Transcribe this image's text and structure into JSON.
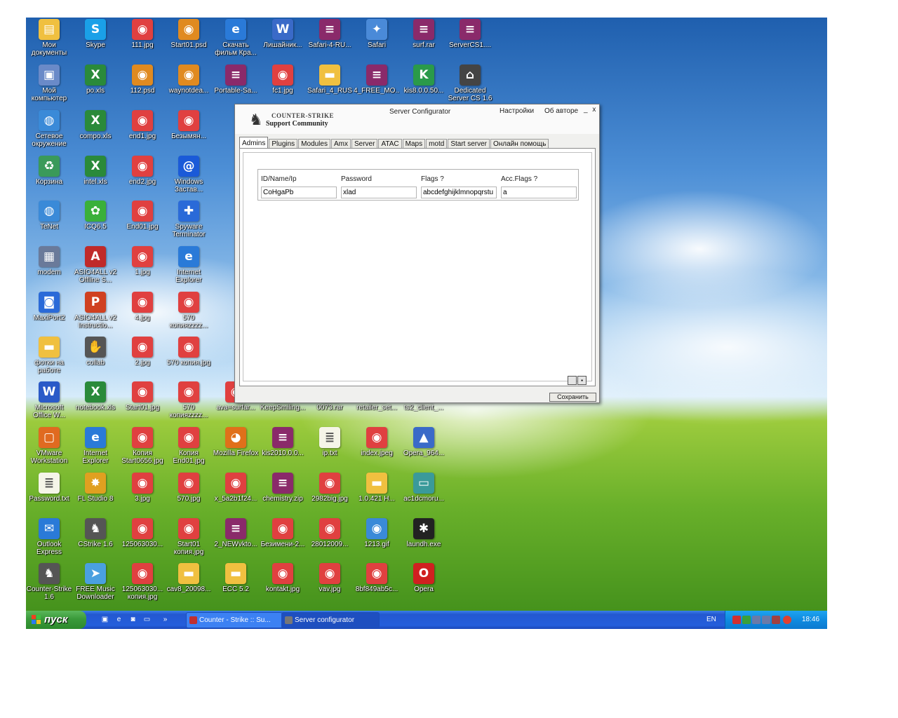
{
  "desktop": {
    "icons": [
      {
        "label": "Мои документы",
        "glyph": "folder-docs-icon",
        "color": "#f0c040",
        "sym": "▤"
      },
      {
        "label": "Skype",
        "glyph": "skype-icon",
        "color": "#1aa0e8",
        "sym": "S"
      },
      {
        "label": "111.jpg",
        "glyph": "jpg-file-icon",
        "color": "#e04040",
        "sym": "◉"
      },
      {
        "label": "Start01.psd",
        "glyph": "psd-file-icon",
        "color": "#e08a20",
        "sym": "◉"
      },
      {
        "label": "Скачать фильм Кра...",
        "glyph": "ie-icon",
        "color": "#2a7ad8",
        "sym": "e"
      },
      {
        "label": "Лишайник...",
        "glyph": "doc-file-icon",
        "color": "#3a6ac8",
        "sym": "W"
      },
      {
        "label": "Safari-4-RU...",
        "glyph": "rar-archive-icon",
        "color": "#8a2a6a",
        "sym": "≡"
      },
      {
        "label": "Safari",
        "glyph": "safari-icon",
        "color": "#4a8ad8",
        "sym": "✦"
      },
      {
        "label": "surf.rar",
        "glyph": "rar-archive-icon",
        "color": "#8a2a6a",
        "sym": "≡"
      },
      {
        "label": "ServerCS1....",
        "glyph": "rar-archive-icon",
        "color": "#8a2a6a",
        "sym": "≡"
      },
      {
        "label": "Мой компьютер",
        "glyph": "computer-icon",
        "color": "#6a8ac8",
        "sym": "▣"
      },
      {
        "label": "po.xls",
        "glyph": "xls-file-icon",
        "color": "#2a8a3a",
        "sym": "X"
      },
      {
        "label": "112.psd",
        "glyph": "psd-file-icon",
        "color": "#e08a20",
        "sym": "◉"
      },
      {
        "label": "waynotdea...",
        "glyph": "psd-file-icon",
        "color": "#e08a20",
        "sym": "◉"
      },
      {
        "label": "Portable-Sa...",
        "glyph": "rar-archive-icon",
        "color": "#8a2a6a",
        "sym": "≡"
      },
      {
        "label": "fc1.jpg",
        "glyph": "jpg-file-icon",
        "color": "#e04040",
        "sym": "◉"
      },
      {
        "label": "Safari_4_RUS",
        "glyph": "folder-icon",
        "color": "#f0c040",
        "sym": "▬"
      },
      {
        "label": "4_FREE_MO...",
        "glyph": "rar-archive-icon",
        "color": "#8a2a6a",
        "sym": "≡"
      },
      {
        "label": "kis8.0.0.50...",
        "glyph": "kaspersky-icon",
        "color": "#2a9a4a",
        "sym": "K"
      },
      {
        "label": "Dedicated Server CS 1.6",
        "glyph": "dedicated-server-icon",
        "color": "#444444",
        "sym": "⌂"
      },
      {
        "label": "Сетевое окружение",
        "glyph": "network-icon",
        "color": "#3a8ad8",
        "sym": "◍"
      },
      {
        "label": "compo.xls",
        "glyph": "xls-file-icon",
        "color": "#2a8a3a",
        "sym": "X"
      },
      {
        "label": "end1.jpg",
        "glyph": "jpg-file-icon",
        "color": "#e04040",
        "sym": "◉"
      },
      {
        "label": "Безымян...",
        "glyph": "jpg-file-icon",
        "color": "#e04040",
        "sym": "◉"
      },
      {
        "label": "Корзина",
        "glyph": "recycle-bin-icon",
        "color": "#3a9a5a",
        "sym": "♻"
      },
      {
        "label": "intel.xls",
        "glyph": "xls-file-icon",
        "color": "#2a8a3a",
        "sym": "X"
      },
      {
        "label": "end2.jpg",
        "glyph": "jpg-file-icon",
        "color": "#e04040",
        "sym": "◉"
      },
      {
        "label": "Windows Застав...",
        "glyph": "at-sign-icon",
        "color": "#1a5ad8",
        "sym": "@"
      },
      {
        "label": "TeNet",
        "glyph": "network-icon",
        "color": "#3a8ad8",
        "sym": "◍"
      },
      {
        "label": "ICQ6.5",
        "glyph": "icq-icon",
        "color": "#3ab03a",
        "sym": "✿"
      },
      {
        "label": "End01.jpg",
        "glyph": "jpg-file-icon",
        "color": "#e04040",
        "sym": "◉"
      },
      {
        "label": "Spyware Terminator",
        "glyph": "shield-icon",
        "color": "#2a6ad8",
        "sym": "✚"
      },
      {
        "label": "modem",
        "glyph": "modem-icon",
        "color": "#6a7a9a",
        "sym": "▦"
      },
      {
        "label": "ASIO4ALL v2 Offline S...",
        "glyph": "asio-icon",
        "color": "#c02a2a",
        "sym": "A"
      },
      {
        "label": "1.jpg",
        "glyph": "jpg-file-icon",
        "color": "#e04040",
        "sym": "◉"
      },
      {
        "label": "Internet Explorer",
        "glyph": "ie-icon",
        "color": "#2a7ad8",
        "sym": "e"
      },
      {
        "label": "MaxiPort2",
        "glyph": "maxiport-icon",
        "color": "#2a6ad8",
        "sym": "◙"
      },
      {
        "label": "ASIO4ALL v2 Instructio...",
        "glyph": "pdf-file-icon",
        "color": "#d04020",
        "sym": "P"
      },
      {
        "label": "4.jpg",
        "glyph": "jpg-file-icon",
        "color": "#e04040",
        "sym": "◉"
      },
      {
        "label": "570 копияzzzz...",
        "glyph": "jpg-file-icon",
        "color": "#e04040",
        "sym": "◉"
      },
      {
        "label": "фотки на работе",
        "glyph": "folder-icon",
        "color": "#f0c040",
        "sym": "▬"
      },
      {
        "label": "collab",
        "glyph": "collab-icon",
        "color": "#555555",
        "sym": "✋"
      },
      {
        "label": "2.jpg",
        "glyph": "jpg-file-icon",
        "color": "#e04040",
        "sym": "◉"
      },
      {
        "label": "570 копия.jpg",
        "glyph": "jpg-file-icon",
        "color": "#e04040",
        "sym": "◉"
      },
      {
        "label": "Microsoft Office W...",
        "glyph": "word-icon",
        "color": "#2a5ac8",
        "sym": "W"
      },
      {
        "label": "notebook.xls",
        "glyph": "xls-file-icon",
        "color": "#2a8a3a",
        "sym": "X"
      },
      {
        "label": "Start01.jpg",
        "glyph": "jpg-file-icon",
        "color": "#e04040",
        "sym": "◉"
      },
      {
        "label": "570 копияzzzz...",
        "glyph": "jpg-file-icon",
        "color": "#e04040",
        "sym": "◉"
      },
      {
        "label": "ava=surfar...",
        "glyph": "jpg-file-icon",
        "color": "#e04040",
        "sym": "◉"
      },
      {
        "label": "KeepSmiling...",
        "glyph": "jpg-file-icon",
        "color": "#e04040",
        "sym": "◉"
      },
      {
        "label": "0073.rar",
        "glyph": "rar-archive-icon",
        "color": "#8a2a6a",
        "sym": "≡"
      },
      {
        "label": "retailer_set...",
        "glyph": "rar-archive-icon",
        "color": "#8a2a6a",
        "sym": "≡"
      },
      {
        "label": "ts2_client_...",
        "glyph": "rar-archive-icon",
        "color": "#8a2a6a",
        "sym": "≡"
      },
      {
        "label": "VMware Workstation",
        "glyph": "vmware-icon",
        "color": "#e06a20",
        "sym": "▢"
      },
      {
        "label": "Internet Explorer",
        "glyph": "ie-icon",
        "color": "#2a7ad8",
        "sym": "e"
      },
      {
        "label": "Копия Start0656.jpg",
        "glyph": "jpg-file-icon",
        "color": "#e04040",
        "sym": "◉"
      },
      {
        "label": "Копия End01.jpg",
        "glyph": "jpg-file-icon",
        "color": "#e04040",
        "sym": "◉"
      },
      {
        "label": "Mozilla Firefox",
        "glyph": "firefox-icon",
        "color": "#e0701a",
        "sym": "◕"
      },
      {
        "label": "kis2010.0.0...",
        "glyph": "rar-archive-icon",
        "color": "#8a2a6a",
        "sym": "≡"
      },
      {
        "label": "ip.txt",
        "glyph": "txt-file-icon",
        "color": "#f5f5e8",
        "sym": "≣"
      },
      {
        "label": "index.jpeg",
        "glyph": "jpg-file-icon",
        "color": "#e04040",
        "sym": "◉"
      },
      {
        "label": "Opera_964...",
        "glyph": "opera-installer-icon",
        "color": "#3a6ac8",
        "sym": "▲"
      },
      {
        "label": "Password.txt",
        "glyph": "txt-file-icon",
        "color": "#f5f5e8",
        "sym": "≣"
      },
      {
        "label": "FL Studio 8",
        "glyph": "fl-studio-icon",
        "color": "#e0a020",
        "sym": "✸"
      },
      {
        "label": "3.jpg",
        "glyph": "jpg-file-icon",
        "color": "#e04040",
        "sym": "◉"
      },
      {
        "label": "570.jpg",
        "glyph": "jpg-file-icon",
        "color": "#e04040",
        "sym": "◉"
      },
      {
        "label": "x_5a2b1f24...",
        "glyph": "jpg-file-icon",
        "color": "#e04040",
        "sym": "◉"
      },
      {
        "label": "chemistry.zip",
        "glyph": "rar-archive-icon",
        "color": "#8a2a6a",
        "sym": "≡"
      },
      {
        "label": "2982big.jpg",
        "glyph": "jpg-file-icon",
        "color": "#e04040",
        "sym": "◉"
      },
      {
        "label": "1.0.421 H...",
        "glyph": "folder-icon",
        "color": "#f0c040",
        "sym": "▬"
      },
      {
        "label": "ac1dcmoru...",
        "glyph": "monitor-icon",
        "color": "#3a9a9a",
        "sym": "▭"
      },
      {
        "label": "Outlook Express",
        "glyph": "outlook-icon",
        "color": "#2a7ad8",
        "sym": "✉"
      },
      {
        "label": "CStrike 1.6",
        "glyph": "cstrike-icon",
        "color": "#555555",
        "sym": "♞"
      },
      {
        "label": "125063030...",
        "glyph": "jpg-file-icon",
        "color": "#e04040",
        "sym": "◉"
      },
      {
        "label": "Start01 копия.jpg",
        "glyph": "jpg-file-icon",
        "color": "#e04040",
        "sym": "◉"
      },
      {
        "label": "2_NEWvkto...",
        "glyph": "rar-archive-icon",
        "color": "#8a2a6a",
        "sym": "≡"
      },
      {
        "label": "Безимени-2...",
        "glyph": "jpg-file-icon",
        "color": "#e04040",
        "sym": "◉"
      },
      {
        "label": "28012009...",
        "glyph": "jpg-file-icon",
        "color": "#e04040",
        "sym": "◉"
      },
      {
        "label": "1213.gif",
        "glyph": "gif-file-icon",
        "color": "#3a8ad8",
        "sym": "◉"
      },
      {
        "label": "laundh.exe",
        "glyph": "spider-exe-icon",
        "color": "#222222",
        "sym": "✱"
      },
      {
        "label": "Counter-Strike 1.6",
        "glyph": "cstrike-icon",
        "color": "#555555",
        "sym": "♞"
      },
      {
        "label": "FREE Music Downloader",
        "glyph": "music-downloader-icon",
        "color": "#4aa0e0",
        "sym": "➤"
      },
      {
        "label": "125063030... копия.jpg",
        "glyph": "jpg-file-icon",
        "color": "#e04040",
        "sym": "◉"
      },
      {
        "label": "cav8_20098...",
        "glyph": "folder-icon",
        "color": "#f0c040",
        "sym": "▬"
      },
      {
        "label": "ECC 5.2",
        "glyph": "folder-icon",
        "color": "#f0c040",
        "sym": "▬"
      },
      {
        "label": "kontakt.jpg",
        "glyph": "jpg-file-icon",
        "color": "#e04040",
        "sym": "◉"
      },
      {
        "label": "vav.jpg",
        "glyph": "jpg-file-icon",
        "color": "#e04040",
        "sym": "◉"
      },
      {
        "label": "8bf849ab5c...",
        "glyph": "jpg-file-icon",
        "color": "#e04040",
        "sym": "◉"
      },
      {
        "label": "Opera",
        "glyph": "opera-icon",
        "color": "#d02020",
        "sym": "O"
      }
    ]
  },
  "window": {
    "title": "Server Configurator",
    "logo_line1": "COUNTER-STRIKE",
    "logo_line2": "Support Community",
    "menu_settings": "Настройки",
    "menu_about": "Об авторе",
    "minimize": "_",
    "close": "x",
    "tabs": [
      "Admins",
      "Plugins",
      "Modules",
      "Amx",
      "Server",
      "ATAC",
      "Maps",
      "motd",
      "Start server",
      "Онлайн помощь"
    ],
    "active_tab": "Admins",
    "table": {
      "headers": [
        "ID/Name/Ip",
        "Password",
        "Flags  ?",
        "Acc.Flags  ?"
      ],
      "row": [
        "CoHgaPb",
        "xlad",
        "abcdefghijklmnopqrstu",
        "a"
      ]
    },
    "save_label": "Сохранить"
  },
  "taskbar": {
    "start_label": "пуск",
    "buttons": [
      "Counter - Strike :: Su...",
      "Server configurator"
    ],
    "language": "EN",
    "clock": "18:46"
  }
}
